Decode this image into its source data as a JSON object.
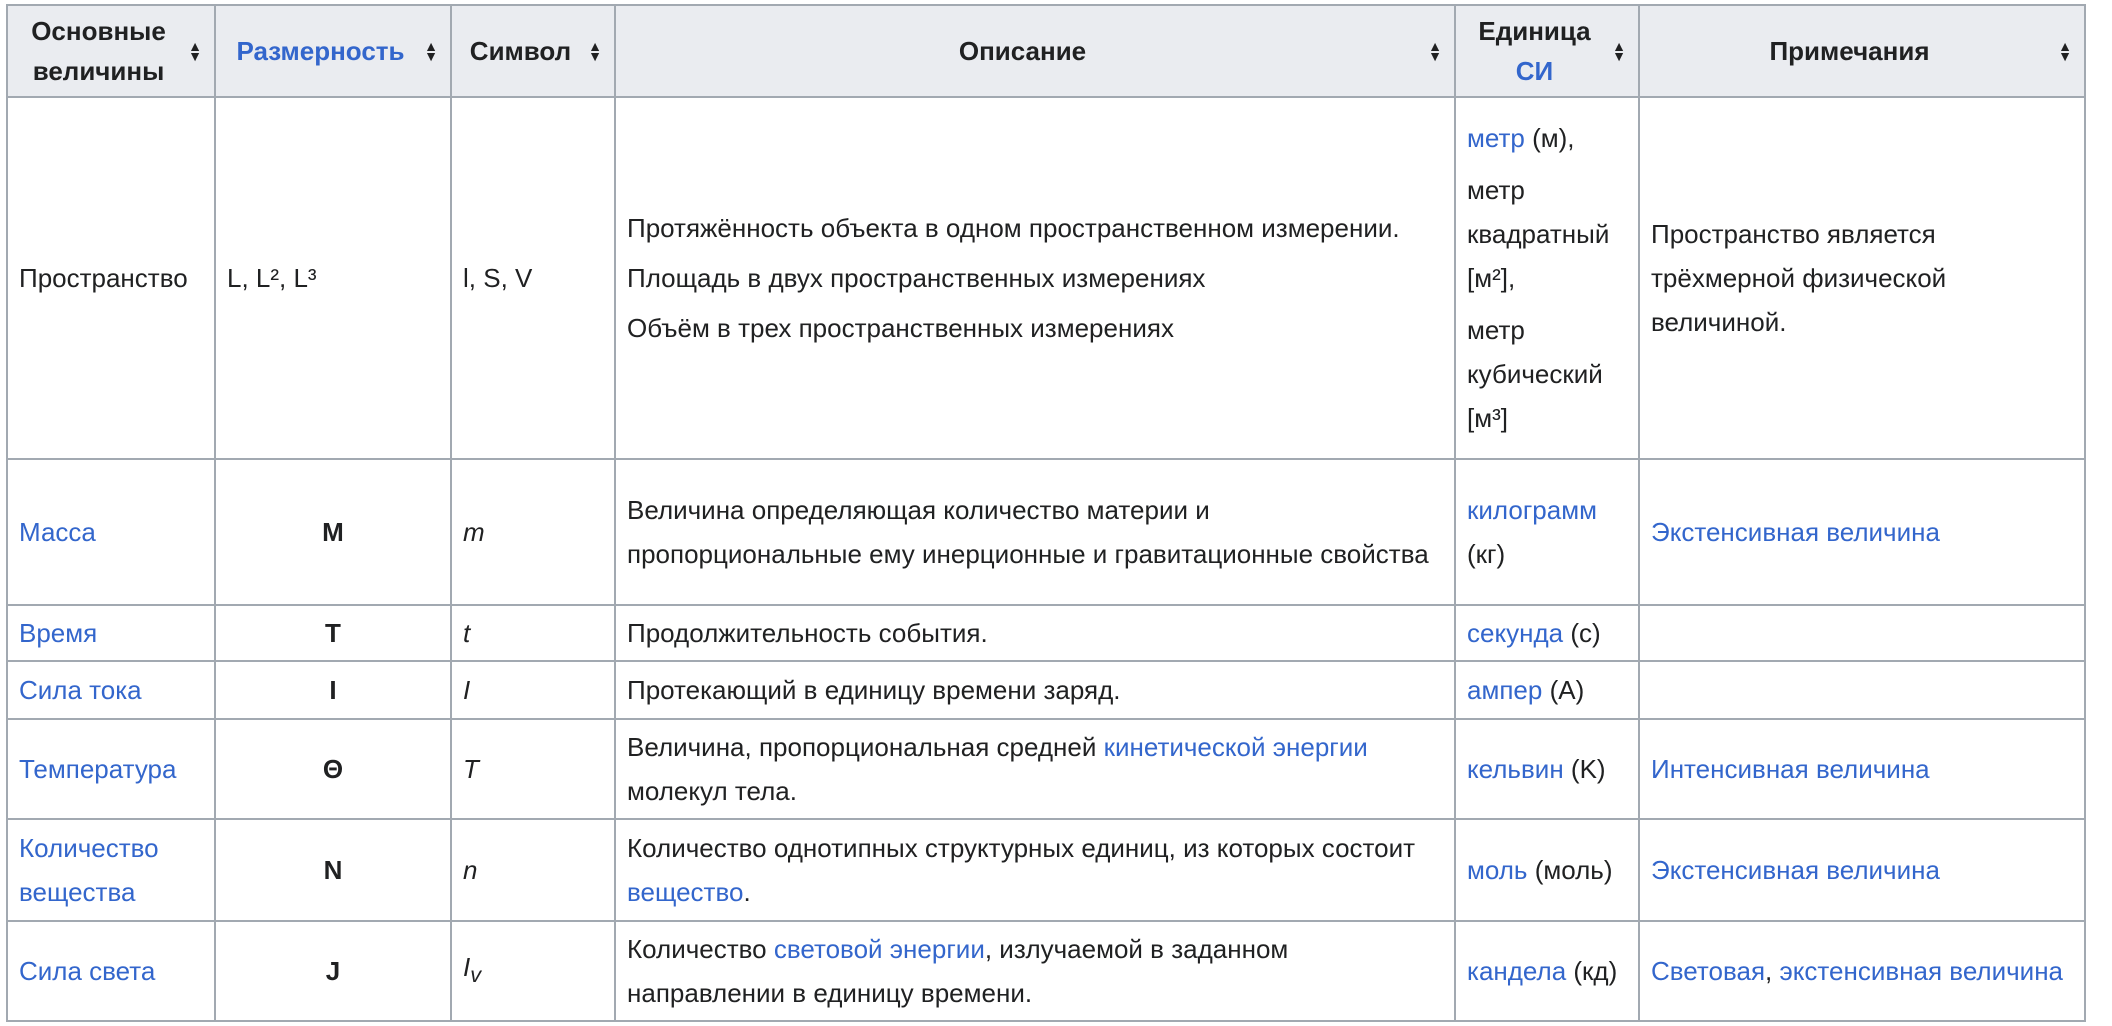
{
  "headers": {
    "base": "Основные величины",
    "dimension": "Размерность",
    "symbol": "Символ",
    "description": "Описание",
    "unit_prefix": "Единица",
    "unit_link": "СИ",
    "notes": "Примечания"
  },
  "rows": [
    {
      "name": "Пространство",
      "dimension": "L, L², L³",
      "symbol": "l, S, V",
      "desc": [
        "Протяжённость объекта в одном пространственном измерении.",
        "Площадь в двух пространственных измерениях",
        "Объём в трех пространственных измерениях"
      ],
      "unit": {
        "p1_link": "метр",
        "p1_text": " (м),",
        "p2": "метр квадратный [м²],",
        "p3": "метр кубический [м³]"
      },
      "notes": "Пространство является трёхмерной физической величиной."
    },
    {
      "name": "Масса",
      "dimension": "M",
      "symbol": "m",
      "desc": "Величина определяющая количество материи и пропорциональные ему инерционные и гравитационные свойства",
      "unit_link": "килограмм",
      "unit_text": " (кг)",
      "notes": "Экстенсивная величина"
    },
    {
      "name": "Время",
      "dimension": "T",
      "symbol": "t",
      "desc": "Продолжительность события.",
      "unit_link": "секунда",
      "unit_text": " (с)",
      "notes": ""
    },
    {
      "name": "Сила тока",
      "dimension": "I",
      "symbol": "I",
      "desc": "Протекающий в единицу времени заряд.",
      "unit_link": "ампер",
      "unit_text": " (A)",
      "notes": ""
    },
    {
      "name": "Температура",
      "dimension": "Θ",
      "symbol": "T",
      "desc_before": "Величина, пропорциональная средней ",
      "desc_link": "кинетической энергии",
      "desc_after": " молекул тела.",
      "unit_link": "кельвин",
      "unit_text": " (K)",
      "notes": "Интенсивная величина"
    },
    {
      "name": "Количество вещества",
      "dimension": "N",
      "symbol": "n",
      "desc_before": "Количество однотипных структурных единиц, из которых состоит ",
      "desc_link": "вещество",
      "desc_after": ".",
      "unit_link": "моль",
      "unit_text": " (моль)",
      "notes": "Экстенсивная величина"
    },
    {
      "name": "Сила света",
      "dimension": "J",
      "symbol": "I",
      "symbol_sub": "v",
      "desc_before": "Количество ",
      "desc_link": "световой энергии",
      "desc_after": ", излучаемой в заданном направлении в единицу времени.",
      "unit_link": "кандела",
      "unit_text": " (кд)",
      "notes_link1": "Световая",
      "notes_sep": ", ",
      "notes_link2": "экстенсивная величина"
    }
  ]
}
